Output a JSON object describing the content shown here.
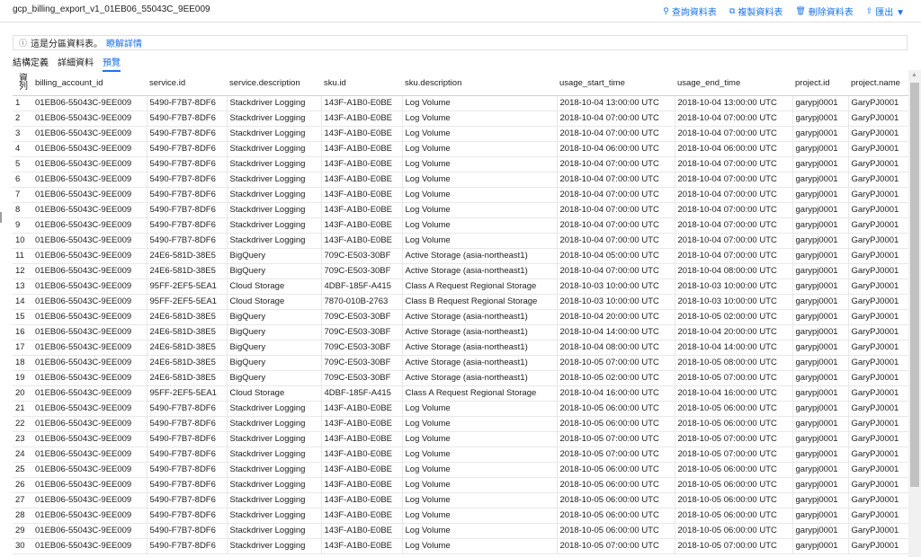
{
  "header": {
    "table_title": "gcp_billing_export_v1_01EB06_55043C_9EE009",
    "actions": [
      {
        "icon": "search-icon",
        "glyph": "⚲",
        "label": "查詢資料表"
      },
      {
        "icon": "copy-icon",
        "glyph": "⧉",
        "label": "複製資料表"
      },
      {
        "icon": "trash-icon",
        "glyph": "🗑",
        "label": "刪除資料表"
      },
      {
        "icon": "export-icon",
        "glyph": "⇪",
        "label": "匯出 ▼"
      }
    ]
  },
  "banner": {
    "icon": "info-icon",
    "message": "這是分區資料表。",
    "link": "瞭解詳情"
  },
  "tabs": [
    "結構定義",
    "詳細資料",
    "預覽"
  ],
  "active_tab": "預覽",
  "grid": {
    "row_header": "資\n列",
    "columns": [
      "billing_account_id",
      "service.id",
      "service.description",
      "sku.id",
      "sku.description",
      "usage_start_time",
      "usage_end_time",
      "project.id",
      "project.name"
    ],
    "rows": [
      [
        "1",
        "01EB06-55043C-9EE009",
        "5490-F7B7-8DF6",
        "Stackdriver Logging",
        "143F-A1B0-E0BE",
        "Log Volume",
        "2018-10-04 13:00:00 UTC",
        "2018-10-04 13:00:00 UTC",
        "garypj0001",
        "GaryPJ0001"
      ],
      [
        "2",
        "01EB06-55043C-9EE009",
        "5490-F7B7-8DF6",
        "Stackdriver Logging",
        "143F-A1B0-E0BE",
        "Log Volume",
        "2018-10-04 07:00:00 UTC",
        "2018-10-04 07:00:00 UTC",
        "garypj0001",
        "GaryPJ0001"
      ],
      [
        "3",
        "01EB06-55043C-9EE009",
        "5490-F7B7-8DF6",
        "Stackdriver Logging",
        "143F-A1B0-E0BE",
        "Log Volume",
        "2018-10-04 07:00:00 UTC",
        "2018-10-04 07:00:00 UTC",
        "garypj0001",
        "GaryPJ0001"
      ],
      [
        "4",
        "01EB06-55043C-9EE009",
        "5490-F7B7-8DF6",
        "Stackdriver Logging",
        "143F-A1B0-E0BE",
        "Log Volume",
        "2018-10-04 06:00:00 UTC",
        "2018-10-04 06:00:00 UTC",
        "garypj0001",
        "GaryPJ0001"
      ],
      [
        "5",
        "01EB06-55043C-9EE009",
        "5490-F7B7-8DF6",
        "Stackdriver Logging",
        "143F-A1B0-E0BE",
        "Log Volume",
        "2018-10-04 07:00:00 UTC",
        "2018-10-04 07:00:00 UTC",
        "garypj0001",
        "GaryPJ0001"
      ],
      [
        "6",
        "01EB06-55043C-9EE009",
        "5490-F7B7-8DF6",
        "Stackdriver Logging",
        "143F-A1B0-E0BE",
        "Log Volume",
        "2018-10-04 07:00:00 UTC",
        "2018-10-04 07:00:00 UTC",
        "garypj0001",
        "GaryPJ0001"
      ],
      [
        "7",
        "01EB06-55043C-9EE009",
        "5490-F7B7-8DF6",
        "Stackdriver Logging",
        "143F-A1B0-E0BE",
        "Log Volume",
        "2018-10-04 07:00:00 UTC",
        "2018-10-04 07:00:00 UTC",
        "garypj0001",
        "GaryPJ0001"
      ],
      [
        "8",
        "01EB06-55043C-9EE009",
        "5490-F7B7-8DF6",
        "Stackdriver Logging",
        "143F-A1B0-E0BE",
        "Log Volume",
        "2018-10-04 07:00:00 UTC",
        "2018-10-04 07:00:00 UTC",
        "garypj0001",
        "GaryPJ0001"
      ],
      [
        "9",
        "01EB06-55043C-9EE009",
        "5490-F7B7-8DF6",
        "Stackdriver Logging",
        "143F-A1B0-E0BE",
        "Log Volume",
        "2018-10-04 07:00:00 UTC",
        "2018-10-04 07:00:00 UTC",
        "garypj0001",
        "GaryPJ0001"
      ],
      [
        "10",
        "01EB06-55043C-9EE009",
        "5490-F7B7-8DF6",
        "Stackdriver Logging",
        "143F-A1B0-E0BE",
        "Log Volume",
        "2018-10-04 07:00:00 UTC",
        "2018-10-04 07:00:00 UTC",
        "garypj0001",
        "GaryPJ0001"
      ],
      [
        "11",
        "01EB06-55043C-9EE009",
        "24E6-581D-38E5",
        "BigQuery",
        "709C-E503-30BF",
        "Active Storage (asia-northeast1)",
        "2018-10-04 05:00:00 UTC",
        "2018-10-04 07:00:00 UTC",
        "garypj0001",
        "GaryPJ0001"
      ],
      [
        "12",
        "01EB06-55043C-9EE009",
        "24E6-581D-38E5",
        "BigQuery",
        "709C-E503-30BF",
        "Active Storage (asia-northeast1)",
        "2018-10-04 07:00:00 UTC",
        "2018-10-04 08:00:00 UTC",
        "garypj0001",
        "GaryPJ0001"
      ],
      [
        "13",
        "01EB06-55043C-9EE009",
        "95FF-2EF5-5EA1",
        "Cloud Storage",
        "4DBF-185F-A415",
        "Class A Request Regional Storage",
        "2018-10-03 10:00:00 UTC",
        "2018-10-03 10:00:00 UTC",
        "garypj0001",
        "GaryPJ0001"
      ],
      [
        "14",
        "01EB06-55043C-9EE009",
        "95FF-2EF5-5EA1",
        "Cloud Storage",
        "7870-010B-2763",
        "Class B Request Regional Storage",
        "2018-10-03 10:00:00 UTC",
        "2018-10-03 10:00:00 UTC",
        "garypj0001",
        "GaryPJ0001"
      ],
      [
        "15",
        "01EB06-55043C-9EE009",
        "24E6-581D-38E5",
        "BigQuery",
        "709C-E503-30BF",
        "Active Storage (asia-northeast1)",
        "2018-10-04 20:00:00 UTC",
        "2018-10-05 02:00:00 UTC",
        "garypj0001",
        "GaryPJ0001"
      ],
      [
        "16",
        "01EB06-55043C-9EE009",
        "24E6-581D-38E5",
        "BigQuery",
        "709C-E503-30BF",
        "Active Storage (asia-northeast1)",
        "2018-10-04 14:00:00 UTC",
        "2018-10-04 20:00:00 UTC",
        "garypj0001",
        "GaryPJ0001"
      ],
      [
        "17",
        "01EB06-55043C-9EE009",
        "24E6-581D-38E5",
        "BigQuery",
        "709C-E503-30BF",
        "Active Storage (asia-northeast1)",
        "2018-10-04 08:00:00 UTC",
        "2018-10-04 14:00:00 UTC",
        "garypj0001",
        "GaryPJ0001"
      ],
      [
        "18",
        "01EB06-55043C-9EE009",
        "24E6-581D-38E5",
        "BigQuery",
        "709C-E503-30BF",
        "Active Storage (asia-northeast1)",
        "2018-10-05 07:00:00 UTC",
        "2018-10-05 08:00:00 UTC",
        "garypj0001",
        "GaryPJ0001"
      ],
      [
        "19",
        "01EB06-55043C-9EE009",
        "24E6-581D-38E5",
        "BigQuery",
        "709C-E503-30BF",
        "Active Storage (asia-northeast1)",
        "2018-10-05 02:00:00 UTC",
        "2018-10-05 07:00:00 UTC",
        "garypj0001",
        "GaryPJ0001"
      ],
      [
        "20",
        "01EB06-55043C-9EE009",
        "95FF-2EF5-5EA1",
        "Cloud Storage",
        "4DBF-185F-A415",
        "Class A Request Regional Storage",
        "2018-10-04 16:00:00 UTC",
        "2018-10-04 16:00:00 UTC",
        "garypj0001",
        "GaryPJ0001"
      ],
      [
        "21",
        "01EB06-55043C-9EE009",
        "5490-F7B7-8DF6",
        "Stackdriver Logging",
        "143F-A1B0-E0BE",
        "Log Volume",
        "2018-10-05 06:00:00 UTC",
        "2018-10-05 06:00:00 UTC",
        "garypj0001",
        "GaryPJ0001"
      ],
      [
        "22",
        "01EB06-55043C-9EE009",
        "5490-F7B7-8DF6",
        "Stackdriver Logging",
        "143F-A1B0-E0BE",
        "Log Volume",
        "2018-10-05 06:00:00 UTC",
        "2018-10-05 06:00:00 UTC",
        "garypj0001",
        "GaryPJ0001"
      ],
      [
        "23",
        "01EB06-55043C-9EE009",
        "5490-F7B7-8DF6",
        "Stackdriver Logging",
        "143F-A1B0-E0BE",
        "Log Volume",
        "2018-10-05 07:00:00 UTC",
        "2018-10-05 07:00:00 UTC",
        "garypj0001",
        "GaryPJ0001"
      ],
      [
        "24",
        "01EB06-55043C-9EE009",
        "5490-F7B7-8DF6",
        "Stackdriver Logging",
        "143F-A1B0-E0BE",
        "Log Volume",
        "2018-10-05 07:00:00 UTC",
        "2018-10-05 07:00:00 UTC",
        "garypj0001",
        "GaryPJ0001"
      ],
      [
        "25",
        "01EB06-55043C-9EE009",
        "5490-F7B7-8DF6",
        "Stackdriver Logging",
        "143F-A1B0-E0BE",
        "Log Volume",
        "2018-10-05 06:00:00 UTC",
        "2018-10-05 06:00:00 UTC",
        "garypj0001",
        "GaryPJ0001"
      ],
      [
        "26",
        "01EB06-55043C-9EE009",
        "5490-F7B7-8DF6",
        "Stackdriver Logging",
        "143F-A1B0-E0BE",
        "Log Volume",
        "2018-10-05 06:00:00 UTC",
        "2018-10-05 06:00:00 UTC",
        "garypj0001",
        "GaryPJ0001"
      ],
      [
        "27",
        "01EB06-55043C-9EE009",
        "5490-F7B7-8DF6",
        "Stackdriver Logging",
        "143F-A1B0-E0BE",
        "Log Volume",
        "2018-10-05 06:00:00 UTC",
        "2018-10-05 06:00:00 UTC",
        "garypj0001",
        "GaryPJ0001"
      ],
      [
        "28",
        "01EB06-55043C-9EE009",
        "5490-F7B7-8DF6",
        "Stackdriver Logging",
        "143F-A1B0-E0BE",
        "Log Volume",
        "2018-10-05 06:00:00 UTC",
        "2018-10-05 06:00:00 UTC",
        "garypj0001",
        "GaryPJ0001"
      ],
      [
        "29",
        "01EB06-55043C-9EE009",
        "5490-F7B7-8DF6",
        "Stackdriver Logging",
        "143F-A1B0-E0BE",
        "Log Volume",
        "2018-10-05 06:00:00 UTC",
        "2018-10-05 06:00:00 UTC",
        "garypj0001",
        "GaryPJ0001"
      ],
      [
        "30",
        "01EB06-55043C-9EE009",
        "5490-F7B7-8DF6",
        "Stackdriver Logging",
        "143F-A1B0-E0BE",
        "Log Volume",
        "2018-10-05 07:00:00 UTC",
        "2018-10-05 07:00:00 UTC",
        "garypj0001",
        "GaryPJ0001"
      ]
    ]
  },
  "colors": {
    "accent": "#1a73e8",
    "border": "#e0e0e0",
    "scroll_thumb": "#c1c1c1"
  }
}
